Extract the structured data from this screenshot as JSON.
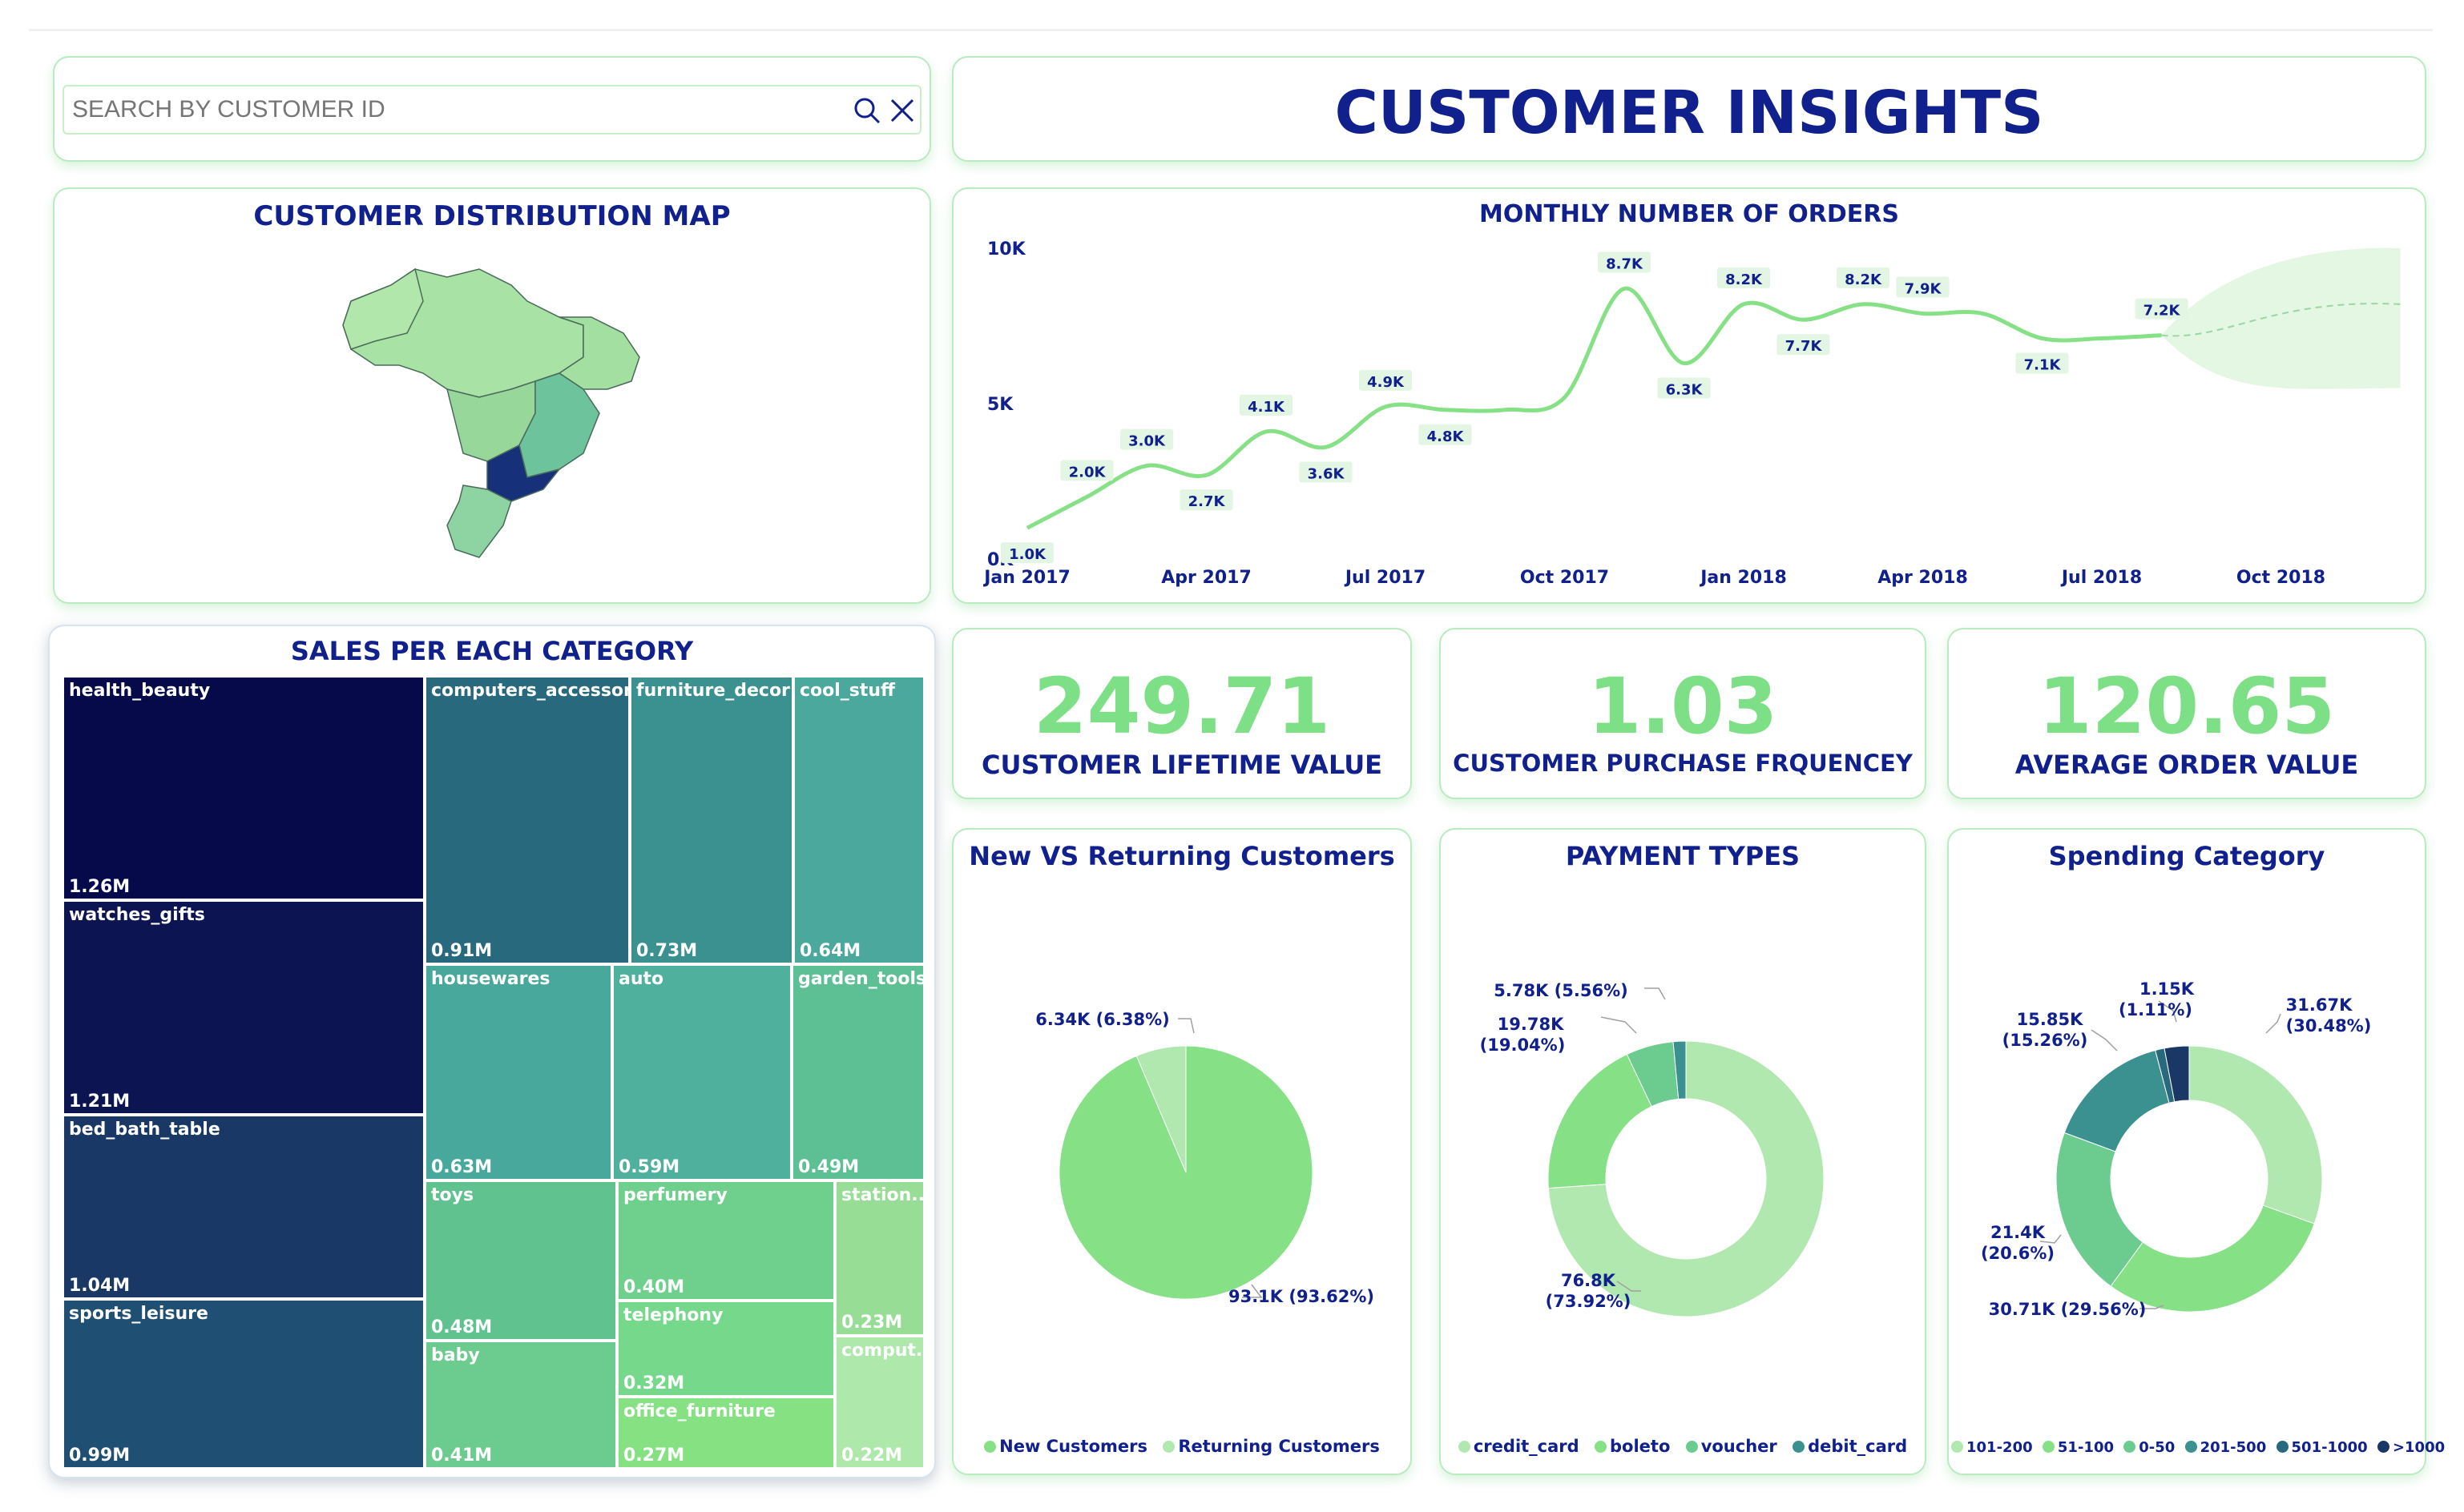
{
  "search": {
    "placeholder": "SEARCH BY CUSTOMER ID",
    "icon_search": "search-icon",
    "icon_clear": "close-icon"
  },
  "header": {
    "title": "CUSTOMER INSIGHTS"
  },
  "map": {
    "title": "CUSTOMER DISTRIBUTION MAP"
  },
  "orders": {
    "title": "MONTHLY NUMBER OF ORDERS",
    "y_ticks": [
      "10K",
      "5K",
      "0K"
    ],
    "x_ticks": [
      "Jan 2017",
      "Apr 2017",
      "Jul 2017",
      "Oct 2017",
      "Jan 2018",
      "Apr 2018",
      "Jul 2018",
      "Oct 2018"
    ]
  },
  "kpis": [
    {
      "value": "249.71",
      "label": "CUSTOMER LIFETIME VALUE"
    },
    {
      "value": "1.03",
      "label": "CUSTOMER PURCHASE FRQUENCEY"
    },
    {
      "value": "120.65",
      "label": "AVERAGE ORDER VALUE"
    }
  ],
  "treemap": {
    "title": "SALES PER EACH CATEGORY",
    "cells": [
      {
        "name": "health_beauty",
        "value": "1.26M",
        "color": "#070a4a"
      },
      {
        "name": "watches_gifts",
        "value": "1.21M",
        "color": "#0c1452"
      },
      {
        "name": "bed_bath_table",
        "value": "1.04M",
        "color": "#1a3866"
      },
      {
        "name": "sports_leisure",
        "value": "0.99M",
        "color": "#1f4f72"
      },
      {
        "name": "computers_accessor...",
        "value": "0.91M",
        "color": "#29697e"
      },
      {
        "name": "furniture_decor",
        "value": "0.73M",
        "color": "#3a9190"
      },
      {
        "name": "cool_stuff",
        "value": "0.64M",
        "color": "#4aa89d"
      },
      {
        "name": "housewares",
        "value": "0.63M",
        "color": "#49a89c"
      },
      {
        "name": "auto",
        "value": "0.59M",
        "color": "#4fb09d"
      },
      {
        "name": "garden_tools",
        "value": "0.49M",
        "color": "#5dbf94"
      },
      {
        "name": "toys",
        "value": "0.48M",
        "color": "#5fc28f"
      },
      {
        "name": "baby",
        "value": "0.41M",
        "color": "#6ccb8f"
      },
      {
        "name": "perfumery",
        "value": "0.40M",
        "color": "#6ed08c"
      },
      {
        "name": "telephony",
        "value": "0.32M",
        "color": "#75d88a"
      },
      {
        "name": "office_furniture",
        "value": "0.27M",
        "color": "#86e182"
      },
      {
        "name": "station...",
        "value": "0.23M",
        "color": "#97dd95"
      },
      {
        "name": "comput...",
        "value": "0.22M",
        "color": "#aee8aa"
      }
    ]
  },
  "new_returning": {
    "title": "New VS Returning Customers",
    "slices": [
      {
        "label": "93.1K (93.62%)",
        "name": "New Customers",
        "color": "#86e186",
        "value": 93.62
      },
      {
        "label": "6.34K (6.38%)",
        "name": "Returning Customers",
        "color": "#b1e8b0",
        "value": 6.38
      }
    ]
  },
  "payment": {
    "title": "PAYMENT TYPES",
    "slices": [
      {
        "label1": "76.8K",
        "label2": "(73.92%)",
        "name": "credit_card",
        "color": "#b1e8b0",
        "value": 73.92
      },
      {
        "label1": "19.78K",
        "label2": "(19.04%)",
        "name": "boleto",
        "color": "#86e186",
        "value": 19.04
      },
      {
        "label1": "5.78K (5.56%)",
        "label2": "",
        "name": "voucher",
        "color": "#6ccb8f",
        "value": 5.56
      },
      {
        "label1": "",
        "label2": "",
        "name": "debit_card",
        "color": "#3a9190",
        "value": 1.48
      }
    ]
  },
  "spending": {
    "title": "Spending Category",
    "slices": [
      {
        "label1": "31.67K",
        "label2": "(30.48%)",
        "name": "101-200",
        "color": "#b1e8b0",
        "value": 30.48
      },
      {
        "label1": "30.71K (29.56%)",
        "label2": "",
        "name": "51-100",
        "color": "#86e186",
        "value": 29.56
      },
      {
        "label1": "21.4K",
        "label2": "(20.6%)",
        "name": "0-50",
        "color": "#6ccb8f",
        "value": 20.6
      },
      {
        "label1": "15.85K",
        "label2": "(15.26%)",
        "name": "201-500",
        "color": "#3a9190",
        "value": 15.26
      },
      {
        "label1": "1.15K",
        "label2": "(1.11%)",
        "name": "501-1000",
        "color": "#29697e",
        "value": 1.11
      },
      {
        "label1": "",
        "label2": "",
        "name": ">1000",
        "color": "#1a3866",
        "value": 2.99
      }
    ]
  },
  "chart_data": {
    "type": "line",
    "title": "MONTHLY NUMBER OF ORDERS",
    "x": [
      "Jan 2017",
      "Feb 2017",
      "Mar 2017",
      "Apr 2017",
      "May 2017",
      "Jun 2017",
      "Jul 2017",
      "Aug 2017",
      "Sep 2017",
      "Oct 2017",
      "Nov 2017",
      "Dec 2017",
      "Jan 2018",
      "Feb 2018",
      "Mar 2018",
      "Apr 2018",
      "May 2018",
      "Jun 2018",
      "Jul 2018",
      "Aug 2018"
    ],
    "series": [
      {
        "values": [
          1.0,
          2.0,
          3.0,
          2.7,
          4.1,
          3.6,
          4.9,
          4.8,
          4.8,
          5.2,
          8.7,
          6.3,
          8.2,
          7.7,
          8.2,
          7.9,
          7.9,
          7.1,
          7.1,
          7.2
        ]
      }
    ],
    "data_labels": [
      "1.0K",
      "2.0K",
      "3.0K",
      "2.7K",
      "4.1K",
      "3.6K",
      "4.9K",
      "4.8K",
      "8.7K",
      "6.3K",
      "8.2K",
      "7.7K",
      "8.2K",
      "7.9K",
      "7.1K",
      "7.2K"
    ],
    "y_unit": "K",
    "ylim": [
      0,
      10
    ],
    "forecast": true,
    "grid": false,
    "legend": "none"
  }
}
